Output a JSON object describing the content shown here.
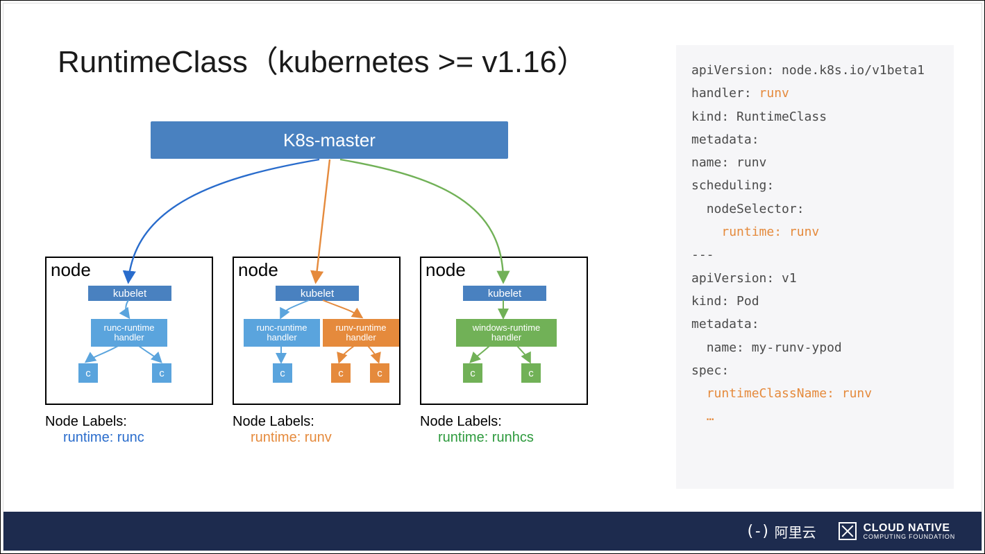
{
  "title": "RuntimeClass（kubernetes >= v1.16）",
  "master": "K8s-master",
  "nodes": {
    "label": "node",
    "kubelet": "kubelet",
    "c": "c",
    "n1": {
      "handler": "runc-runtime handler"
    },
    "n2": {
      "h1": "runc-runtime handler",
      "h2": "runv-runtime handler"
    },
    "n3": {
      "handler": "windows-runtime handler"
    }
  },
  "labels": {
    "title": "Node Labels:",
    "l1": "runtime: runc",
    "l2": "runtime: runv",
    "l3": "runtime: runhcs"
  },
  "code": {
    "l1": "apiVersion: node.k8s.io/v1beta1",
    "l2": "handler: ",
    "l2h": "runv",
    "l3": "kind: RuntimeClass",
    "l4": "metadata:",
    "l5": "name: runv",
    "l6": "scheduling:",
    "l7": "  nodeSelector:",
    "l8h": "    runtime: runv",
    "sep": "---",
    "l9": "apiVersion: v1",
    "l10": "kind: Pod",
    "l11": "metadata:",
    "l12": "  name: my-runv-ypod",
    "l13": "spec:",
    "l14h": "  runtimeClassName: runv",
    "l15h": "  …"
  },
  "footer": {
    "aliyun": "阿里云",
    "cncf_big": "CLOUD NATIVE",
    "cncf_small": "COMPUTING FOUNDATION"
  }
}
